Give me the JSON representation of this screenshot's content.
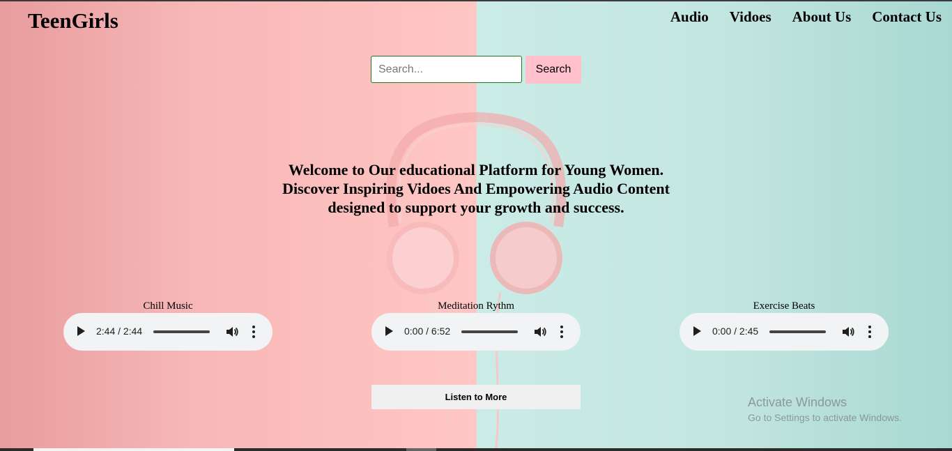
{
  "site": {
    "logo": "TeenGirls"
  },
  "nav": {
    "items": [
      "Audio",
      "Vidoes",
      "About Us",
      "Contact Us"
    ]
  },
  "search": {
    "placeholder": "Search...",
    "button_label": "Search"
  },
  "hero": {
    "line1": "Welcome to Our educational Platform for Young Women.",
    "line2": "Discover Inspiring Vidoes And Empowering Audio Content",
    "line3": "designed to support your growth and success."
  },
  "tracks": [
    {
      "title": "Chill Music",
      "time": "2:44 / 2:44"
    },
    {
      "title": "Meditation Rythm",
      "time": "0:00 / 6:52"
    },
    {
      "title": "Exercise Beats",
      "time": "0:00 / 2:45"
    }
  ],
  "cta": {
    "listen_more": "Listen to More"
  },
  "watermark": {
    "line1": "Activate Windows",
    "line2": "Go to Settings to activate Windows."
  },
  "colors": {
    "left_bg": "#ffc7c4",
    "right_bg": "#cbece6",
    "search_button": "#ffc0cb",
    "player_bg": "#f1f3f4"
  }
}
